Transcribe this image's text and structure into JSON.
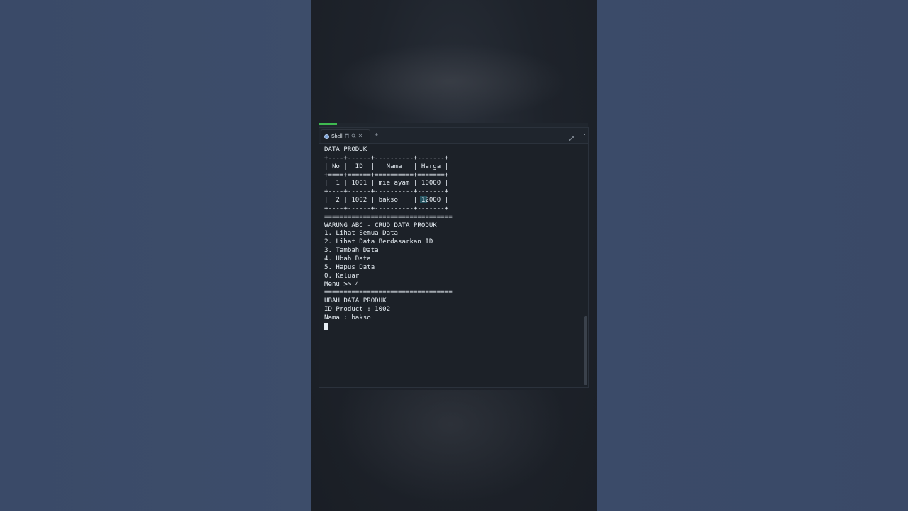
{
  "tab": {
    "label": "Shell",
    "add_label": "+",
    "more_label": "⋯"
  },
  "console": {
    "lines": [
      "DATA PRODUK",
      "",
      "+----+------+----------+-------+",
      "| No |  ID  |   Nama   | Harga |",
      "+====+======+==========+=======+",
      "|  1 | 1001 | mie ayam | 10000 |",
      "+----+------+----------+-------+",
      "|  2 | 1002 | bakso    | 12000 |",
      "+----+------+----------+-------+",
      "",
      "=================================",
      "WARUNG ABC - CRUD DATA PRODUK",
      "",
      "1. Lihat Semua Data",
      "2. Lihat Data Berdasarkan ID",
      "3. Tambah Data",
      "4. Ubah Data",
      "5. Hapus Data",
      "",
      "0. Keluar",
      "",
      "Menu >> 4",
      "=================================",
      "UBAH DATA PRODUK",
      "",
      "ID Product : 1002",
      "Nama : bakso",
      ""
    ]
  },
  "colors": {
    "terminal_bg": "#1c2128",
    "terminal_fg": "#e6edf3",
    "accent": "#3fb950"
  },
  "icons": [
    "shell-icon",
    "trash-icon",
    "search-icon",
    "close-icon",
    "expand-icon",
    "more-icon"
  ]
}
